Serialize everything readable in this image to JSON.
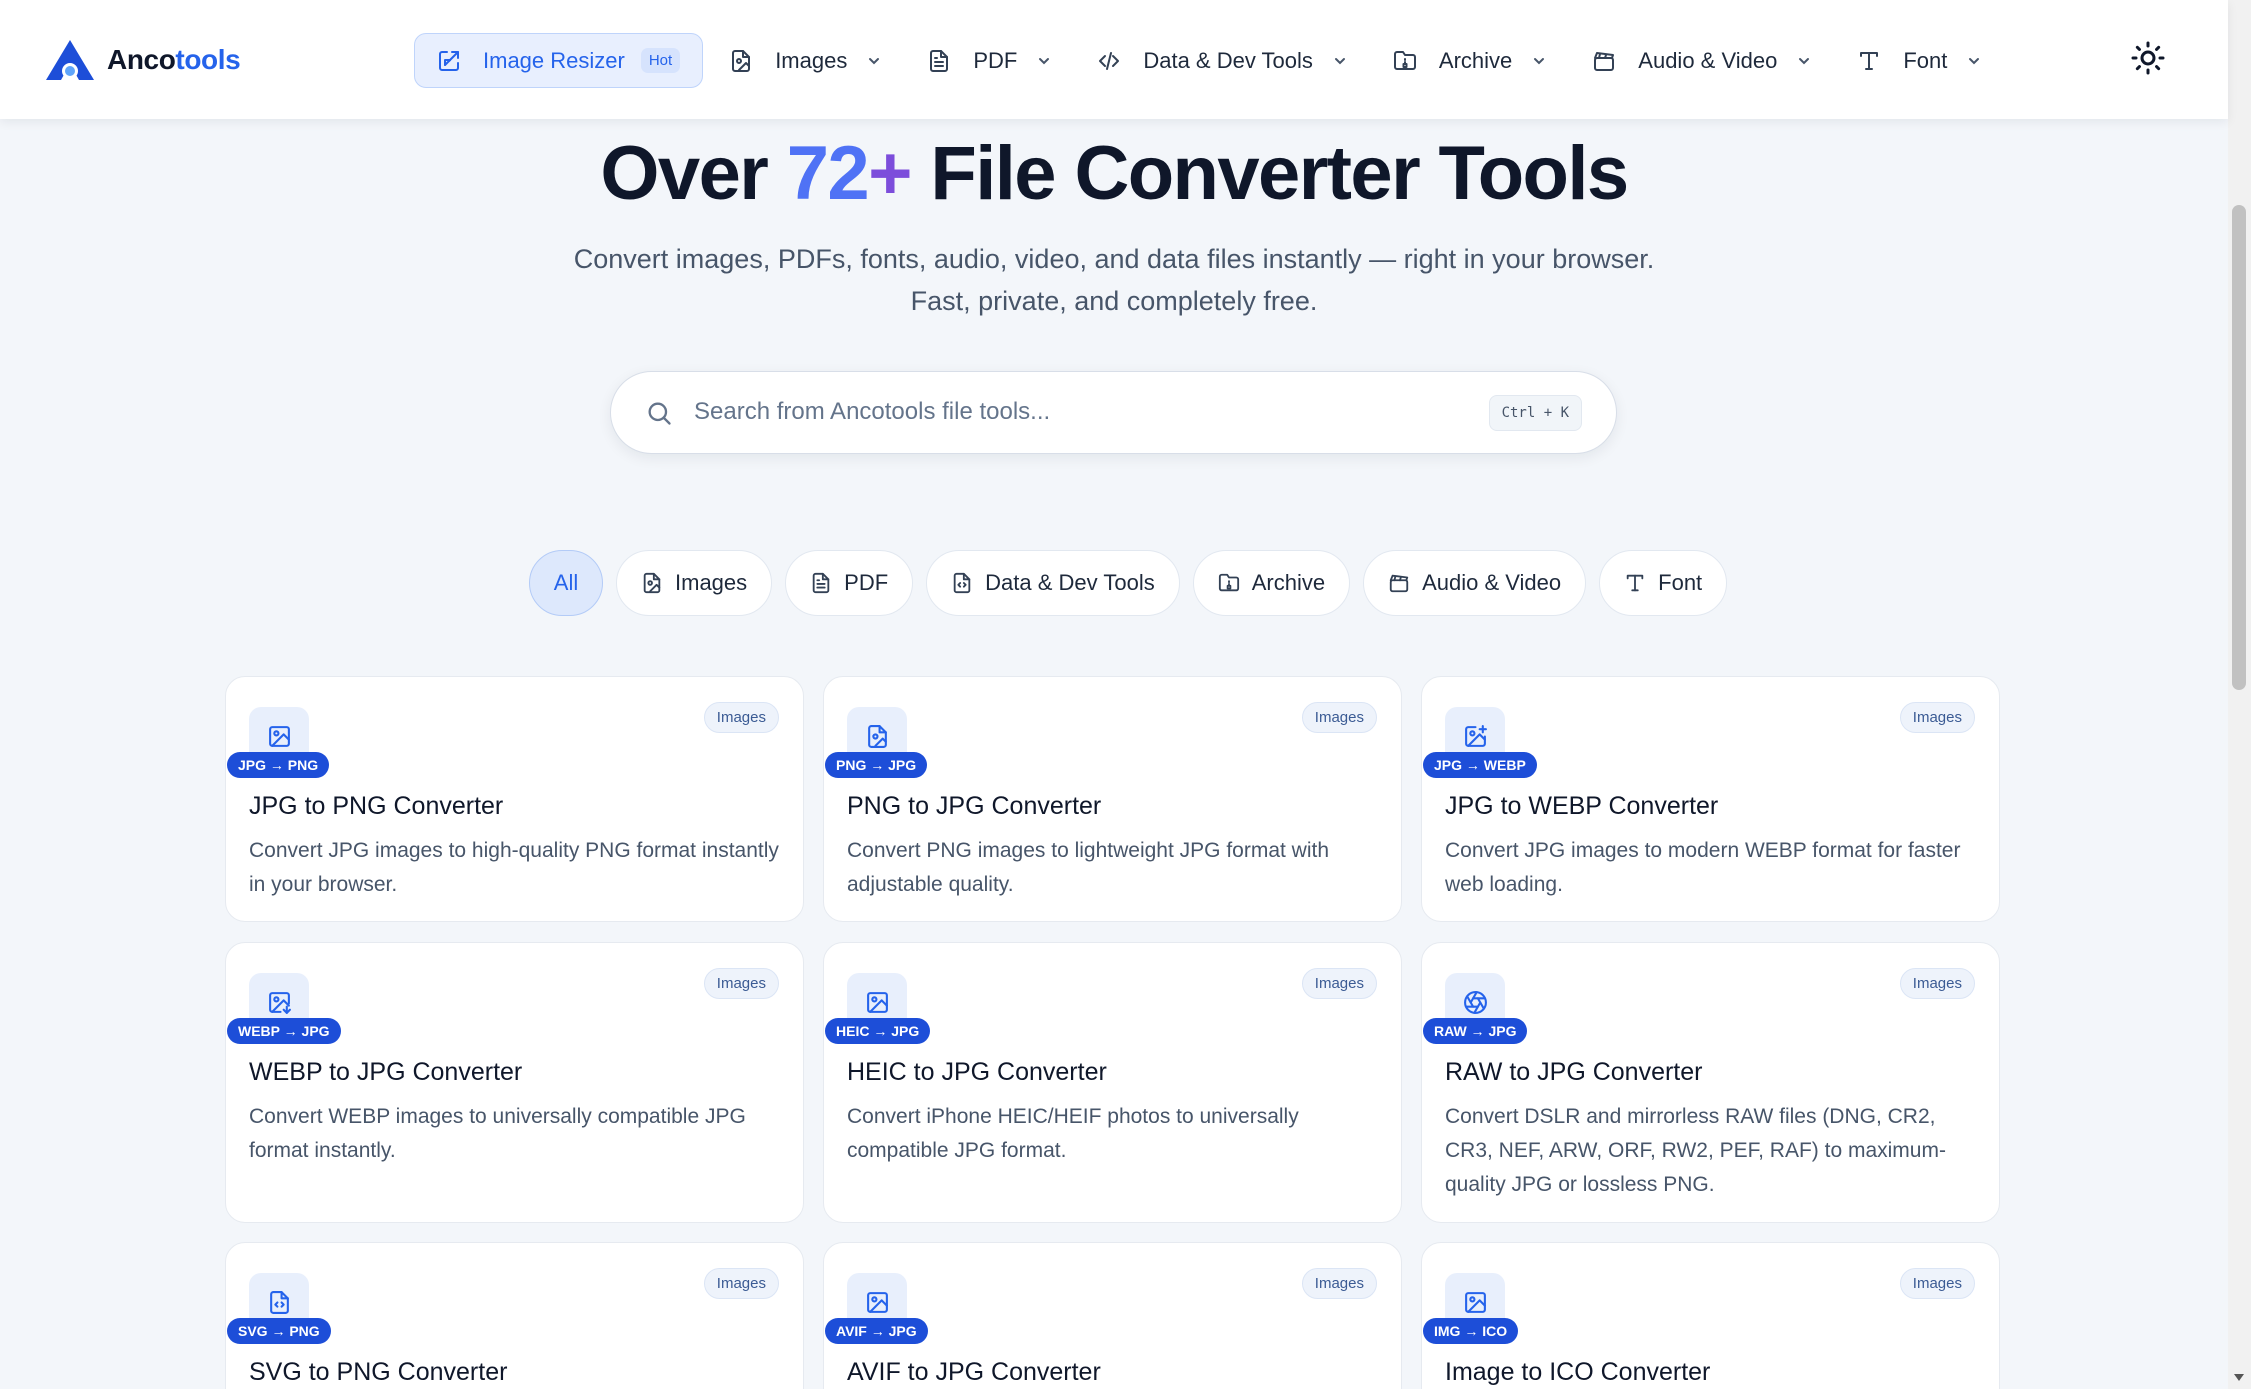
{
  "brand": {
    "name_part1": "Anco",
    "name_part2": "tools"
  },
  "nav": [
    {
      "label": "Image Resizer",
      "icon": "resize-icon",
      "badge": "Hot",
      "active": true
    },
    {
      "label": "Images",
      "icon": "image-file-icon"
    },
    {
      "label": "PDF",
      "icon": "pdf-file-icon"
    },
    {
      "label": "Data & Dev Tools",
      "icon": "code-icon"
    },
    {
      "label": "Archive",
      "icon": "archive-folder-icon"
    },
    {
      "label": "Audio & Video",
      "icon": "clapperboard-icon"
    },
    {
      "label": "Font",
      "icon": "type-icon"
    }
  ],
  "hero": {
    "title_pre": "Over ",
    "title_num": "72",
    "title_plus": "+",
    "title_post": " File Converter Tools",
    "subtitle": "Convert images, PDFs, fonts, audio, video, and data files instantly — right in your browser. Fast, private, and completely free."
  },
  "search": {
    "placeholder": "Search from Ancotools file tools...",
    "shortcut": "Ctrl + K"
  },
  "filters": [
    {
      "label": "All",
      "active": true
    },
    {
      "label": "Images",
      "icon": "image-file-icon"
    },
    {
      "label": "PDF",
      "icon": "pdf-file-icon"
    },
    {
      "label": "Data & Dev Tools",
      "icon": "data-file-icon"
    },
    {
      "label": "Archive",
      "icon": "archive-folder-icon"
    },
    {
      "label": "Audio & Video",
      "icon": "clapperboard-icon"
    },
    {
      "label": "Font",
      "icon": "type-icon"
    }
  ],
  "cards": [
    {
      "badge": "JPG → PNG",
      "title": "JPG to PNG Converter",
      "desc": "Convert JPG images to high-quality PNG format instantly in your browser.",
      "category": "Images",
      "icon": "image-icon"
    },
    {
      "badge": "PNG → JPG",
      "title": "PNG to JPG Converter",
      "desc": "Convert PNG images to lightweight JPG format with adjustable quality.",
      "category": "Images",
      "icon": "image-file-icon"
    },
    {
      "badge": "JPG → WEBP",
      "title": "JPG to WEBP Converter",
      "desc": "Convert JPG images to modern WEBP format for faster web loading.",
      "category": "Images",
      "icon": "image-plus-icon"
    },
    {
      "badge": "WEBP → JPG",
      "title": "WEBP to JPG Converter",
      "desc": "Convert WEBP images to universally compatible JPG format instantly.",
      "category": "Images",
      "icon": "image-down-icon"
    },
    {
      "badge": "HEIC → JPG",
      "title": "HEIC to JPG Converter",
      "desc": "Convert iPhone HEIC/HEIF photos to universally compatible JPG format.",
      "category": "Images",
      "icon": "image-icon"
    },
    {
      "badge": "RAW → JPG",
      "title": "RAW to JPG Converter",
      "desc": "Convert DSLR and mirrorless RAW files (DNG, CR2, CR3, NEF, ARW, ORF, RW2, PEF, RAF) to maximum-quality JPG or lossless PNG.",
      "category": "Images",
      "icon": "aperture-icon"
    },
    {
      "badge": "SVG → PNG",
      "title": "SVG to PNG Converter",
      "desc": "",
      "category": "Images",
      "icon": "code-file-icon"
    },
    {
      "badge": "AVIF → JPG",
      "title": "AVIF to JPG Converter",
      "desc": "",
      "category": "Images",
      "icon": "image-icon"
    },
    {
      "badge": "IMG → ICO",
      "title": "Image to ICO Converter",
      "desc": "",
      "category": "Images",
      "icon": "image-icon"
    }
  ]
}
